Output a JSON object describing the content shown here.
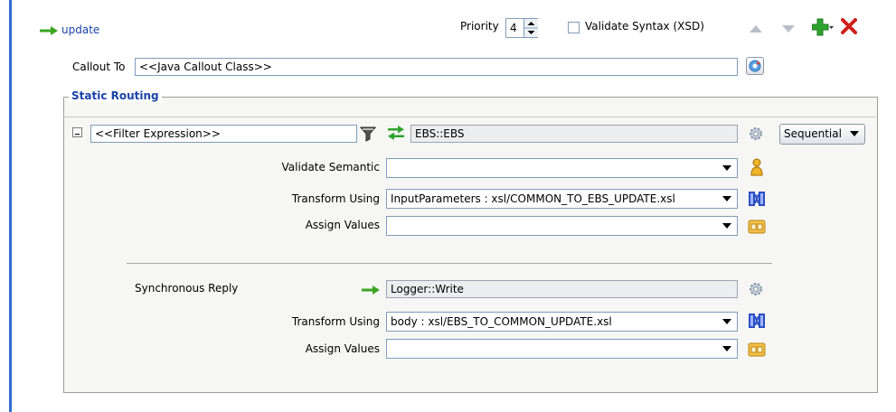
{
  "route": {
    "name": "update"
  },
  "header": {
    "priority_label": "Priority",
    "priority_value": "4",
    "validate_syntax_label": "Validate Syntax (XSD)"
  },
  "callout": {
    "label": "Callout To",
    "value": "<<Java Callout Class>>"
  },
  "static_routing": {
    "title": "Static Routing",
    "filter_expression": "<<Filter Expression>>",
    "target": "EBS::EBS",
    "execution": "Sequential",
    "validate_semantic_label": "Validate Semantic",
    "validate_semantic_value": "",
    "transform_label": "Transform Using",
    "transform_value": "InputParameters : xsl/COMMON_TO_EBS_UPDATE.xsl",
    "assign_label": "Assign Values",
    "assign_value": ""
  },
  "sync_reply": {
    "label": "Synchronous Reply",
    "target": "Logger::Write",
    "transform_label": "Transform Using",
    "transform_value": "body : xsl/EBS_TO_COMMON_UPDATE.xsl",
    "assign_label": "Assign Values",
    "assign_value": ""
  },
  "colors": {
    "accent": "#2f6fce",
    "link": "#1a43a8",
    "add": "#2da32d",
    "delete": "#d0201c"
  },
  "icons": [
    "arrow-right-icon",
    "spinner-icon",
    "checkbox-icon",
    "move-up-icon",
    "move-down-icon",
    "add-icon",
    "delete-icon",
    "browse-icon",
    "collapse-icon",
    "filter-icon",
    "bidirectional-arrow-icon",
    "gear-icon",
    "person-icon",
    "transform-icon",
    "assign-icon"
  ]
}
